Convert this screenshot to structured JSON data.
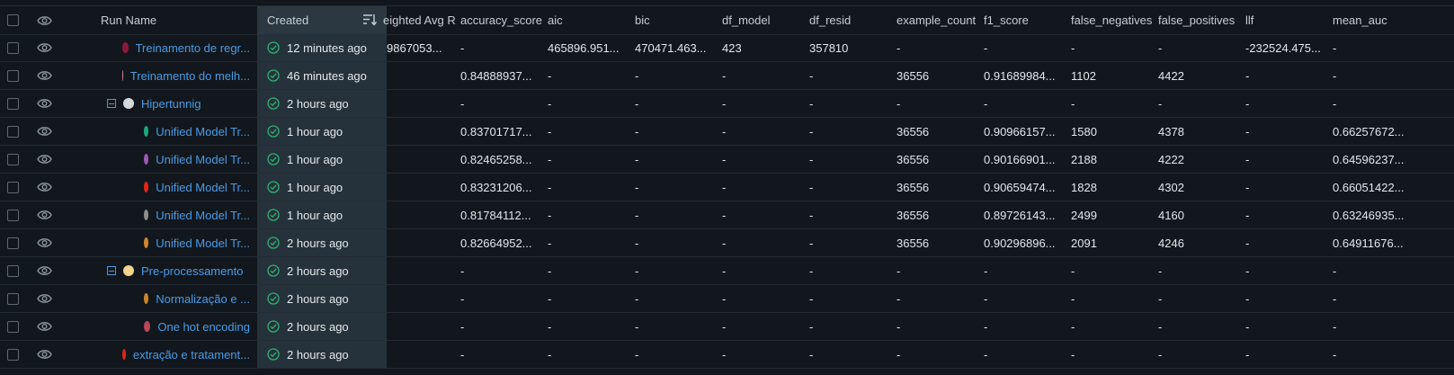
{
  "header": {
    "run_name": "Run Name",
    "created": "Created",
    "cols": [
      "eighted Avg R",
      "accuracy_score",
      "aic",
      "bic",
      "df_model",
      "df_resid",
      "example_count",
      "f1_score",
      "false_negatives",
      "false_positives",
      "llf",
      "mean_auc"
    ]
  },
  "colors": {
    "link": "#4a9be8",
    "success": "#2fb170",
    "created_bg": "#26323b"
  },
  "rows": [
    {
      "name": "Treinamento de regr...",
      "color": "#8b1a3a",
      "indent": 1,
      "collapse": false,
      "created": "12 minutes ago",
      "vals": [
        "9867053...",
        "-",
        "465896.951...",
        "470471.463...",
        "423",
        "357810",
        "-",
        "-",
        "-",
        "-",
        "-232524.475...",
        "-"
      ]
    },
    {
      "name": "Treinamento do melh...",
      "color": "#d98a99",
      "indent": 1,
      "collapse": false,
      "created": "46 minutes ago",
      "vals": [
        "",
        "0.84888937...",
        "-",
        "-",
        "-",
        "-",
        "36556",
        "0.91689984...",
        "1102",
        "4422",
        "-",
        "-"
      ]
    },
    {
      "name": "Hipertunnig",
      "color": "#d4d8dc",
      "indent": 1,
      "collapse": true,
      "created": "2 hours ago",
      "vals": [
        "",
        "-",
        "-",
        "-",
        "-",
        "-",
        "-",
        "-",
        "-",
        "-",
        "-",
        "-"
      ]
    },
    {
      "name": "Unified Model Tr...",
      "color": "#1ea77b",
      "indent": 2,
      "collapse": false,
      "created": "1 hour ago",
      "vals": [
        "",
        "0.83701717...",
        "-",
        "-",
        "-",
        "-",
        "36556",
        "0.90966157...",
        "1580",
        "4378",
        "-",
        "0.66257672..."
      ]
    },
    {
      "name": "Unified Model Tr...",
      "color": "#9b59b6",
      "indent": 2,
      "collapse": false,
      "created": "1 hour ago",
      "vals": [
        "",
        "0.82465258...",
        "-",
        "-",
        "-",
        "-",
        "36556",
        "0.90166901...",
        "2188",
        "4222",
        "-",
        "0.64596237..."
      ]
    },
    {
      "name": "Unified Model Tr...",
      "color": "#e0261b",
      "indent": 2,
      "collapse": false,
      "created": "1 hour ago",
      "vals": [
        "",
        "0.83231206...",
        "-",
        "-",
        "-",
        "-",
        "36556",
        "0.90659474...",
        "1828",
        "4302",
        "-",
        "0.66051422..."
      ]
    },
    {
      "name": "Unified Model Tr...",
      "color": "#8e8e8e",
      "indent": 2,
      "collapse": false,
      "created": "1 hour ago",
      "vals": [
        "",
        "0.81784112...",
        "-",
        "-",
        "-",
        "-",
        "36556",
        "0.89726143...",
        "2499",
        "4160",
        "-",
        "0.63246935..."
      ]
    },
    {
      "name": "Unified Model Tr...",
      "color": "#d1862e",
      "indent": 2,
      "collapse": false,
      "created": "2 hours ago",
      "vals": [
        "",
        "0.82664952...",
        "-",
        "-",
        "-",
        "-",
        "36556",
        "0.90296896...",
        "2091",
        "4246",
        "-",
        "0.64911676..."
      ]
    },
    {
      "name": "Pre-processamento",
      "color": "#f4d48c",
      "indent": 1,
      "collapse": true,
      "created": "2 hours ago",
      "vals": [
        "",
        "-",
        "-",
        "-",
        "-",
        "-",
        "-",
        "-",
        "-",
        "-",
        "-",
        "-"
      ]
    },
    {
      "name": "Normalização e ...",
      "color": "#c8862a",
      "indent": 2,
      "collapse": false,
      "created": "2 hours ago",
      "vals": [
        "",
        "-",
        "-",
        "-",
        "-",
        "-",
        "-",
        "-",
        "-",
        "-",
        "-",
        "-"
      ]
    },
    {
      "name": "One hot encoding",
      "color": "#b7475a",
      "indent": 2,
      "collapse": false,
      "created": "2 hours ago",
      "vals": [
        "",
        "-",
        "-",
        "-",
        "-",
        "-",
        "-",
        "-",
        "-",
        "-",
        "-",
        "-"
      ]
    },
    {
      "name": "extração e tratament...",
      "color": "#e0261b",
      "indent": 1,
      "collapse": false,
      "created": "2 hours ago",
      "vals": [
        "",
        "-",
        "-",
        "-",
        "-",
        "-",
        "-",
        "-",
        "-",
        "-",
        "-",
        "-"
      ]
    }
  ]
}
